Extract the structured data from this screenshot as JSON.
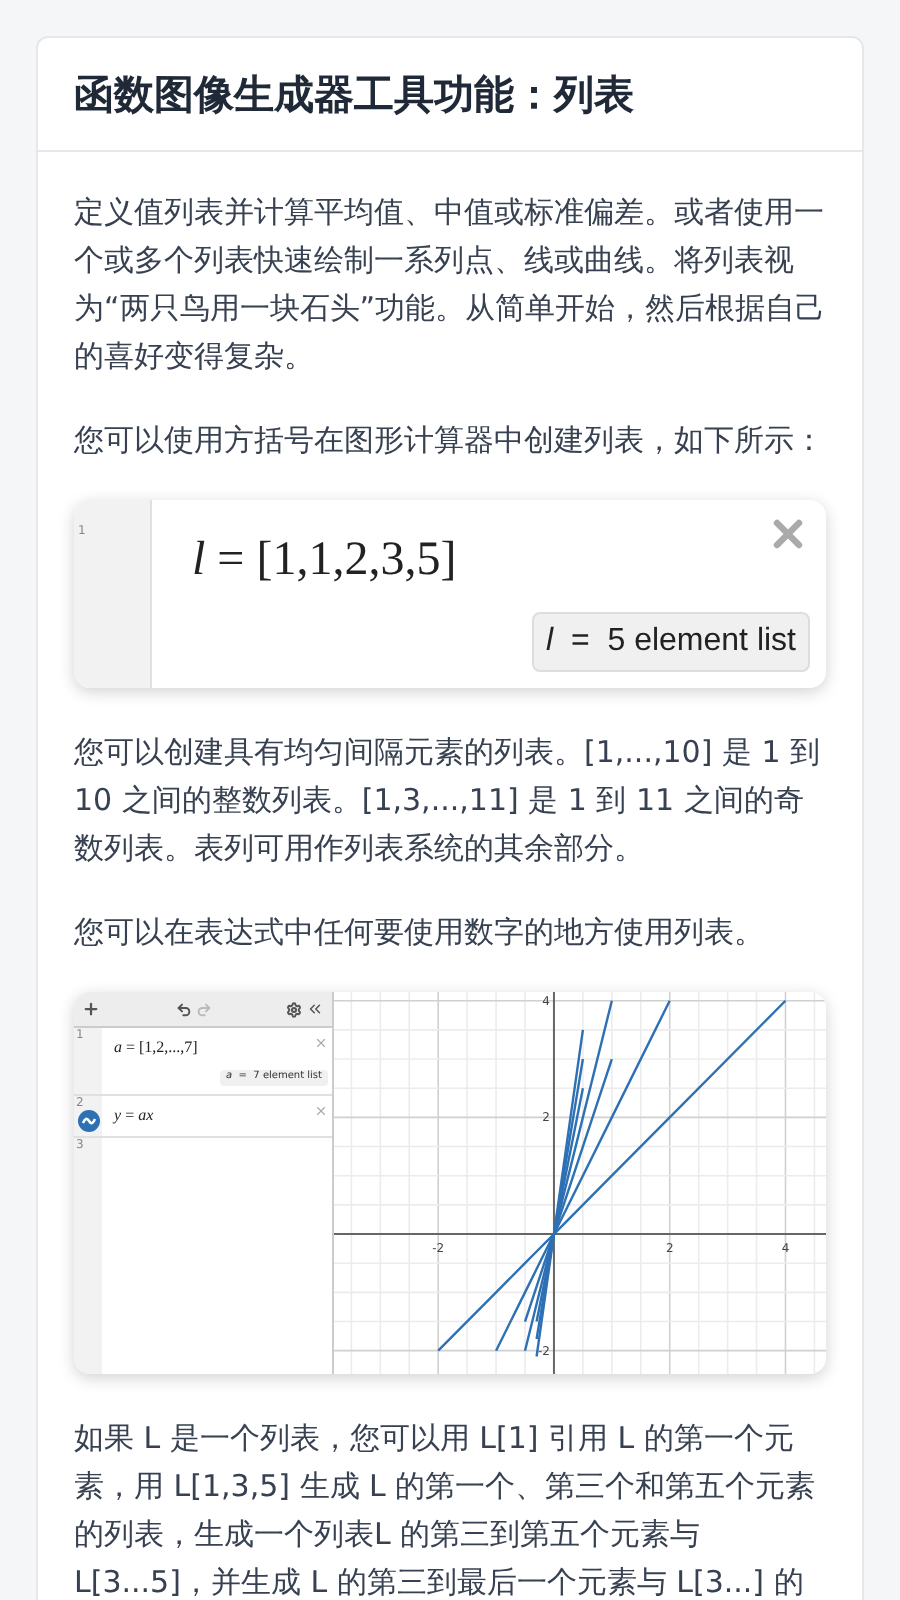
{
  "title": "函数图像生成器工具功能：列表",
  "content": [
    {
      "kind": "paragraph",
      "text": "定义值列表并计算平均值、中值或标准偏差。或者使用一个或多个列表快速绘制一系列点、线或曲线。将列表视为“两只鸟用一块石头”功能。从简单开始，然后根据自己的喜好变得复杂。"
    },
    {
      "kind": "paragraph",
      "text": "您可以使用方括号在图形计算器中创建列表，如下所示："
    },
    {
      "kind": "expression_figure",
      "line_number": "1",
      "expression": "*l* = [1,1,2,3,5]",
      "result": "*l*  =  5 element list"
    },
    {
      "kind": "paragraph",
      "text": "您可以创建具有均匀间隔元素的列表。[1,...,10] 是 1 到 10 之间的整数列表。[1,3,...,11] 是 1 到 11 之间的奇数列表。表列可用作列表系统的其余部分。"
    },
    {
      "kind": "paragraph",
      "text": "您可以在表达式中任何要使用数字的地方使用列表。"
    },
    {
      "kind": "calculator_figure",
      "expressions": [
        {
          "line_number": "1",
          "text": "*a* = [1,2,...,7]",
          "result": "*a*  =  7 element list",
          "graphed": false
        },
        {
          "line_number": "2",
          "text": "*y* = *ax*",
          "graphed": true
        },
        {
          "line_number": "3",
          "graphed": false
        }
      ],
      "graph": {
        "chart_data": {
          "type": "line",
          "grid": true,
          "x": [
            -2,
            -1,
            -0.5,
            -0.3,
            0,
            0.5,
            1,
            2,
            4
          ],
          "xlim": [
            -3.8,
            4.7
          ],
          "ylim": [
            -2.4,
            4.15
          ],
          "xticks": [
            -2,
            2,
            4
          ],
          "yticks": [
            -2,
            2,
            4
          ],
          "series": [
            {
              "color": "#2d70b3",
              "values": [
                -2,
                -1,
                -0.5,
                -0.3,
                0,
                0.5,
                1,
                2,
                4
              ]
            },
            {
              "color": "#2d70b3",
              "values": [
                null,
                -2,
                -1,
                -0.6,
                0,
                1,
                2,
                4,
                null
              ]
            },
            {
              "color": "#2d70b3",
              "values": [
                null,
                null,
                -1.5,
                -0.9,
                0,
                1.5,
                3,
                null,
                null
              ]
            },
            {
              "color": "#2d70b3",
              "values": [
                null,
                null,
                -2,
                -1.2,
                0,
                2,
                4,
                null,
                null
              ]
            },
            {
              "color": "#2d70b3",
              "values": [
                null,
                null,
                null,
                -1.5,
                0,
                2.5,
                null,
                null,
                null
              ]
            },
            {
              "color": "#2d70b3",
              "values": [
                null,
                null,
                null,
                -1.8,
                0,
                3,
                null,
                null,
                null
              ]
            },
            {
              "color": "#2d70b3",
              "values": [
                null,
                null,
                null,
                -2.1,
                0,
                3.5,
                null,
                null,
                null
              ]
            }
          ]
        }
      }
    },
    {
      "kind": "paragraph",
      "text": "如果 L 是一个列表，您可以用 L[1] 引用 L 的第一个元素，用 L[1,3,5] 生成 L 的第一个、第三个和第五个元素的列表，生成一个列表L 的第三到第五个元素与 L[3...5]，并生成 L 的第三到最后一个元素与 L[3...] 的"
    }
  ]
}
